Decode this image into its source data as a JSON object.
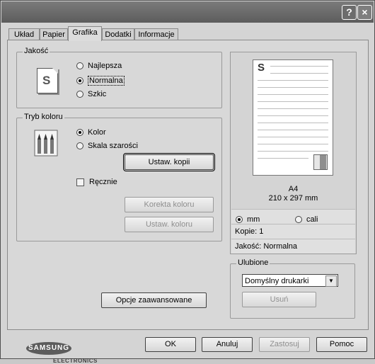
{
  "titlebar": {
    "help_label": "?",
    "close_label": "×"
  },
  "tabs": [
    {
      "label": "Układ"
    },
    {
      "label": "Papier"
    },
    {
      "label": "Grafika",
      "active": true
    },
    {
      "label": "Dodatki"
    },
    {
      "label": "Informacje"
    }
  ],
  "quality": {
    "title": "Jakość",
    "icon_letter": "S",
    "options": [
      {
        "label": "Najlepsza",
        "checked": false
      },
      {
        "label": "Normalna",
        "checked": true
      },
      {
        "label": "Szkic",
        "checked": false
      }
    ]
  },
  "color_mode": {
    "title": "Tryb koloru",
    "options": [
      {
        "label": "Kolor",
        "checked": true
      },
      {
        "label": "Skala szarości",
        "checked": false
      }
    ],
    "copy_button": "Ustaw. kopii",
    "manual_label": "Ręcznie",
    "manual_checked": false,
    "color_correction_button": "Korekta koloru",
    "color_settings_button": "Ustaw. koloru"
  },
  "advanced_button": "Opcje zaawansowane",
  "preview": {
    "paper_letter": "S",
    "paper_name": "A4",
    "paper_size": "210 x 297 mm",
    "unit_options": [
      {
        "label": "mm",
        "checked": true
      },
      {
        "label": "cali",
        "checked": false
      }
    ],
    "copies": "Kopie: 1",
    "quality": "Jakość: Normalna"
  },
  "favorites": {
    "title": "Ulubione",
    "selected": "Domyślny drukarki",
    "delete_button": "Usuń"
  },
  "logo": {
    "brand": "SAMSUNG",
    "sub": "ELECTRONICS"
  },
  "footer": {
    "ok": "OK",
    "cancel": "Anuluj",
    "apply": "Zastosuj",
    "help": "Pomoc"
  }
}
